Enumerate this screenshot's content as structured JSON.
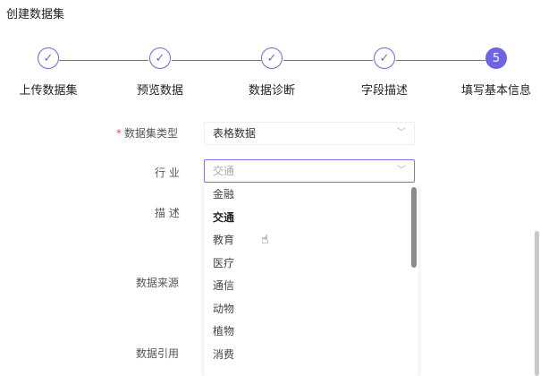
{
  "page": {
    "title": "创建数据集"
  },
  "steps": [
    {
      "label": "上传数据集",
      "icon": "check-icon",
      "symbol": "✓"
    },
    {
      "label": "预览数据",
      "icon": "check-icon",
      "symbol": "✓"
    },
    {
      "label": "数据诊断",
      "icon": "check-icon",
      "symbol": "✓"
    },
    {
      "label": "字段描述",
      "icon": "check-icon",
      "symbol": "✓"
    },
    {
      "label": "填写基本信息",
      "number": "5"
    }
  ],
  "form": {
    "type_label": "数据集类型",
    "type_value": "表格数据",
    "industry_label": "行 业",
    "industry_value": "交通",
    "description_label": "描 述",
    "source_label": "数据来源",
    "citation_label": "数据引用"
  },
  "dropdown": {
    "options": [
      "金融",
      "交通",
      "教育",
      "医疗",
      "通信",
      "动物",
      "植物",
      "消费"
    ],
    "selected": "交通"
  },
  "colors": {
    "accent": "#6f63e6",
    "required": "#f04b4b"
  }
}
